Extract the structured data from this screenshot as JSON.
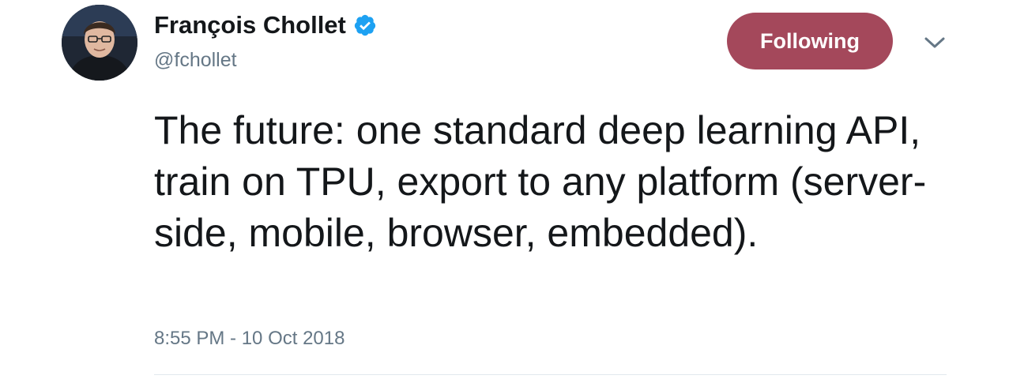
{
  "tweet": {
    "author": {
      "display_name": "François Chollet",
      "handle": "@fchollet",
      "verified": true,
      "avatar_icon": "profile-photo"
    },
    "follow_button_label": "Following",
    "menu_icon": "chevron-down-icon",
    "text": "The future: one standard deep learning API, train on TPU, export to any platform (server-side, mobile, browser, embedded).",
    "timestamp": "8:55 PM - 10 Oct 2018"
  },
  "colors": {
    "follow_button_bg": "#a4485b",
    "verified_badge": "#1da1f2",
    "secondary_text": "#657786",
    "primary_text": "#14171a"
  }
}
